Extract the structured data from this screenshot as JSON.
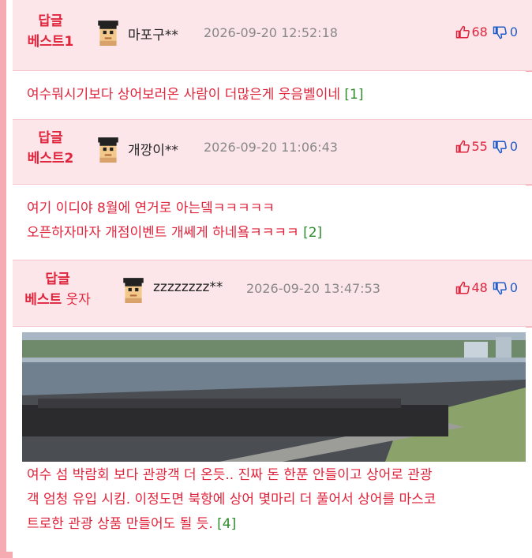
{
  "comments": [
    {
      "rank_line1": "답글",
      "rank_line2": "베스트1",
      "rank_extra": "",
      "nickname": "마포구**",
      "timestamp": "2026-09-20 12:52:18",
      "up": "68",
      "down": "0",
      "lines": [
        "여수뭐시기보다 상어보러온 사람이 더많은게 웃음벨이네"
      ],
      "ref": "[1]"
    },
    {
      "rank_line1": "답글",
      "rank_line2": "베스트2",
      "rank_extra": "",
      "nickname": "개깡이**",
      "timestamp": "2026-09-20 11:06:43",
      "up": "55",
      "down": "0",
      "lines": [
        "여기 이디야 8월에 연거로 아는뎈ㅋㅋㅋㅋㅋ",
        "오픈하자마자 개점이벤트 개쎄게 하네욬ㅋㅋㅋㅋ"
      ],
      "ref": "[2]"
    },
    {
      "rank_line1": "답글",
      "rank_line2": "베스트",
      "rank_extra": " 웃자",
      "nickname": "zzzzzzzz**",
      "timestamp": "2026-09-20 13:47:53",
      "up": "48",
      "down": "0",
      "lines": [
        "여수 섬 박람회 보다 관광객 더 온듯.. 진짜 돈 한푼 안들이고 상어로 관광",
        "객 엄청 유입 시킴. 이정도면 북항에 상어 몇마리 더 풀어서 상어를 마스코",
        "트로한 관광 상품 만들어도 될 듯."
      ],
      "ref": "[4]"
    }
  ],
  "colors": {
    "accent": "#e0243c",
    "header_bg": "#fde6ea",
    "border": "#f6aab2",
    "down": "#1e5ec8",
    "ref": "#2e8b2e"
  },
  "icons": {
    "up": "thumbs-up-icon",
    "down": "thumbs-down-icon",
    "avatar": "pixel-avatar-icon"
  }
}
